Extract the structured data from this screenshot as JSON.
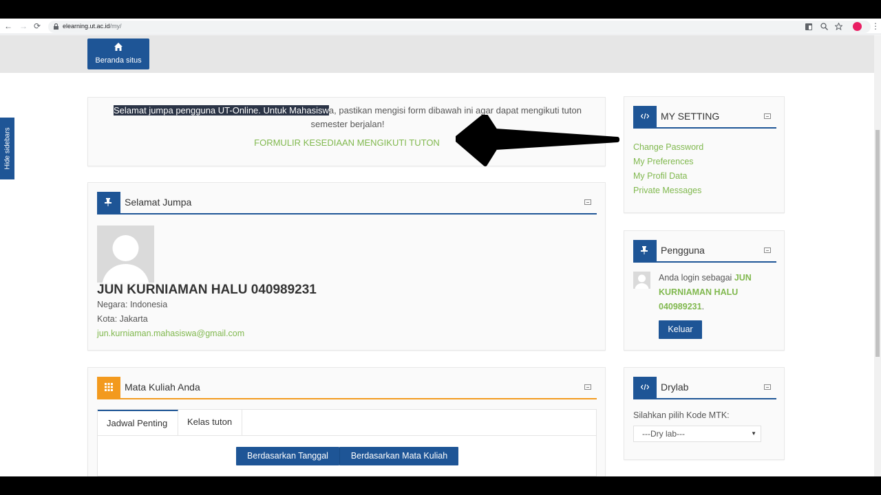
{
  "browser": {
    "url_host": "elearning.ut.ac.id",
    "url_path": "/my/",
    "nav_back": "←",
    "nav_forward": "→",
    "nav_reload": "⟳",
    "more": "⋮"
  },
  "sidebar_toggle": "Hide sidebars",
  "home": {
    "label": "Beranda situs"
  },
  "notice": {
    "highlighted": "Selamat jumpa pengguna UT-Online. Untuk Mahasisw",
    "rest": "a, pastikan mengisi form dibawah ini agar dapat mengikuti tuton semester berjalan!",
    "link": "FORMULIR KESEDIAAN MENGIKUTI TUTON"
  },
  "welcome": {
    "title": "Selamat Jumpa",
    "name": "JUN KURNIAMAN HALU 040989231",
    "country": "Negara: Indonesia",
    "city": "Kota: Jakarta",
    "email": "jun.kurniaman.mahasiswa@gmail.com"
  },
  "courses": {
    "title": "Mata Kuliah Anda",
    "tabs": [
      "Jadwal Penting",
      "Kelas tuton"
    ],
    "btn_date": "Berdasarkan Tanggal",
    "btn_course": "Berdasarkan Mata Kuliah"
  },
  "my_setting": {
    "title": "MY SETTING",
    "links": [
      "Change Password",
      "My Preferences",
      "My Profil Data",
      "Private Messages"
    ]
  },
  "pengguna": {
    "title": "Pengguna",
    "prefix": "Anda login sebagai ",
    "user": "JUN KURNIAMAN HALU 040989231",
    "suffix": ".",
    "logout": "Keluar"
  },
  "drylab": {
    "title": "Drylab",
    "label": "Silahkan pilih Kode MTK:",
    "selected": "---Dry lab---",
    "caret": "▼"
  },
  "colors": {
    "primary": "#1e5596",
    "link_green": "#80b84e",
    "accent_orange": "#f39a1e"
  }
}
